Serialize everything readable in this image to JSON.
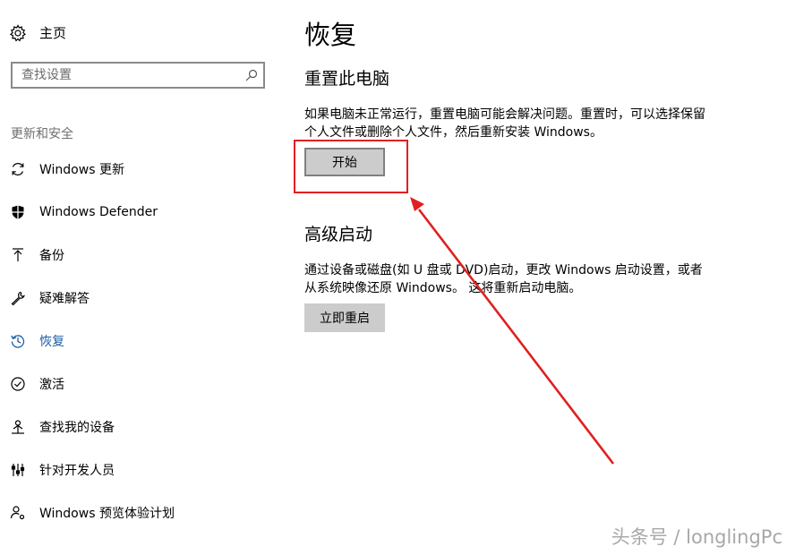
{
  "sidebar": {
    "home_label": "主页",
    "search": {
      "placeholder": "查找设置"
    },
    "section_title": "更新和安全",
    "items": [
      {
        "label": "Windows 更新",
        "icon": "refresh-icon"
      },
      {
        "label": "Windows Defender",
        "icon": "shield-icon"
      },
      {
        "label": "备份",
        "icon": "upload-arrow-icon"
      },
      {
        "label": "疑难解答",
        "icon": "wrench-icon"
      },
      {
        "label": "恢复",
        "icon": "history-icon",
        "active": true
      },
      {
        "label": "激活",
        "icon": "check-circle-icon"
      },
      {
        "label": "查找我的设备",
        "icon": "person-locate-icon"
      },
      {
        "label": "针对开发人员",
        "icon": "developer-tools-icon"
      },
      {
        "label": "Windows 预览体验计划",
        "icon": "person-settings-icon"
      }
    ]
  },
  "main": {
    "title": "恢复",
    "reset": {
      "heading": "重置此电脑",
      "description": "如果电脑未正常运行，重置电脑可能会解决问题。重置时，可以选择保留个人文件或删除个人文件，然后重新安装 Windows。",
      "button_label": "开始"
    },
    "advanced": {
      "heading": "高级启动",
      "description": "通过设备或磁盘(如 U 盘或 DVD)启动，更改 Windows 启动设置，或者从系统映像还原 Windows。 这将重新启动电脑。",
      "button_label": "立即重启"
    }
  },
  "watermark": "头条号 / longlingPc",
  "colors": {
    "accent": "#1a5ea8",
    "annotation": "#e02020",
    "button_bg": "#cccccc"
  }
}
